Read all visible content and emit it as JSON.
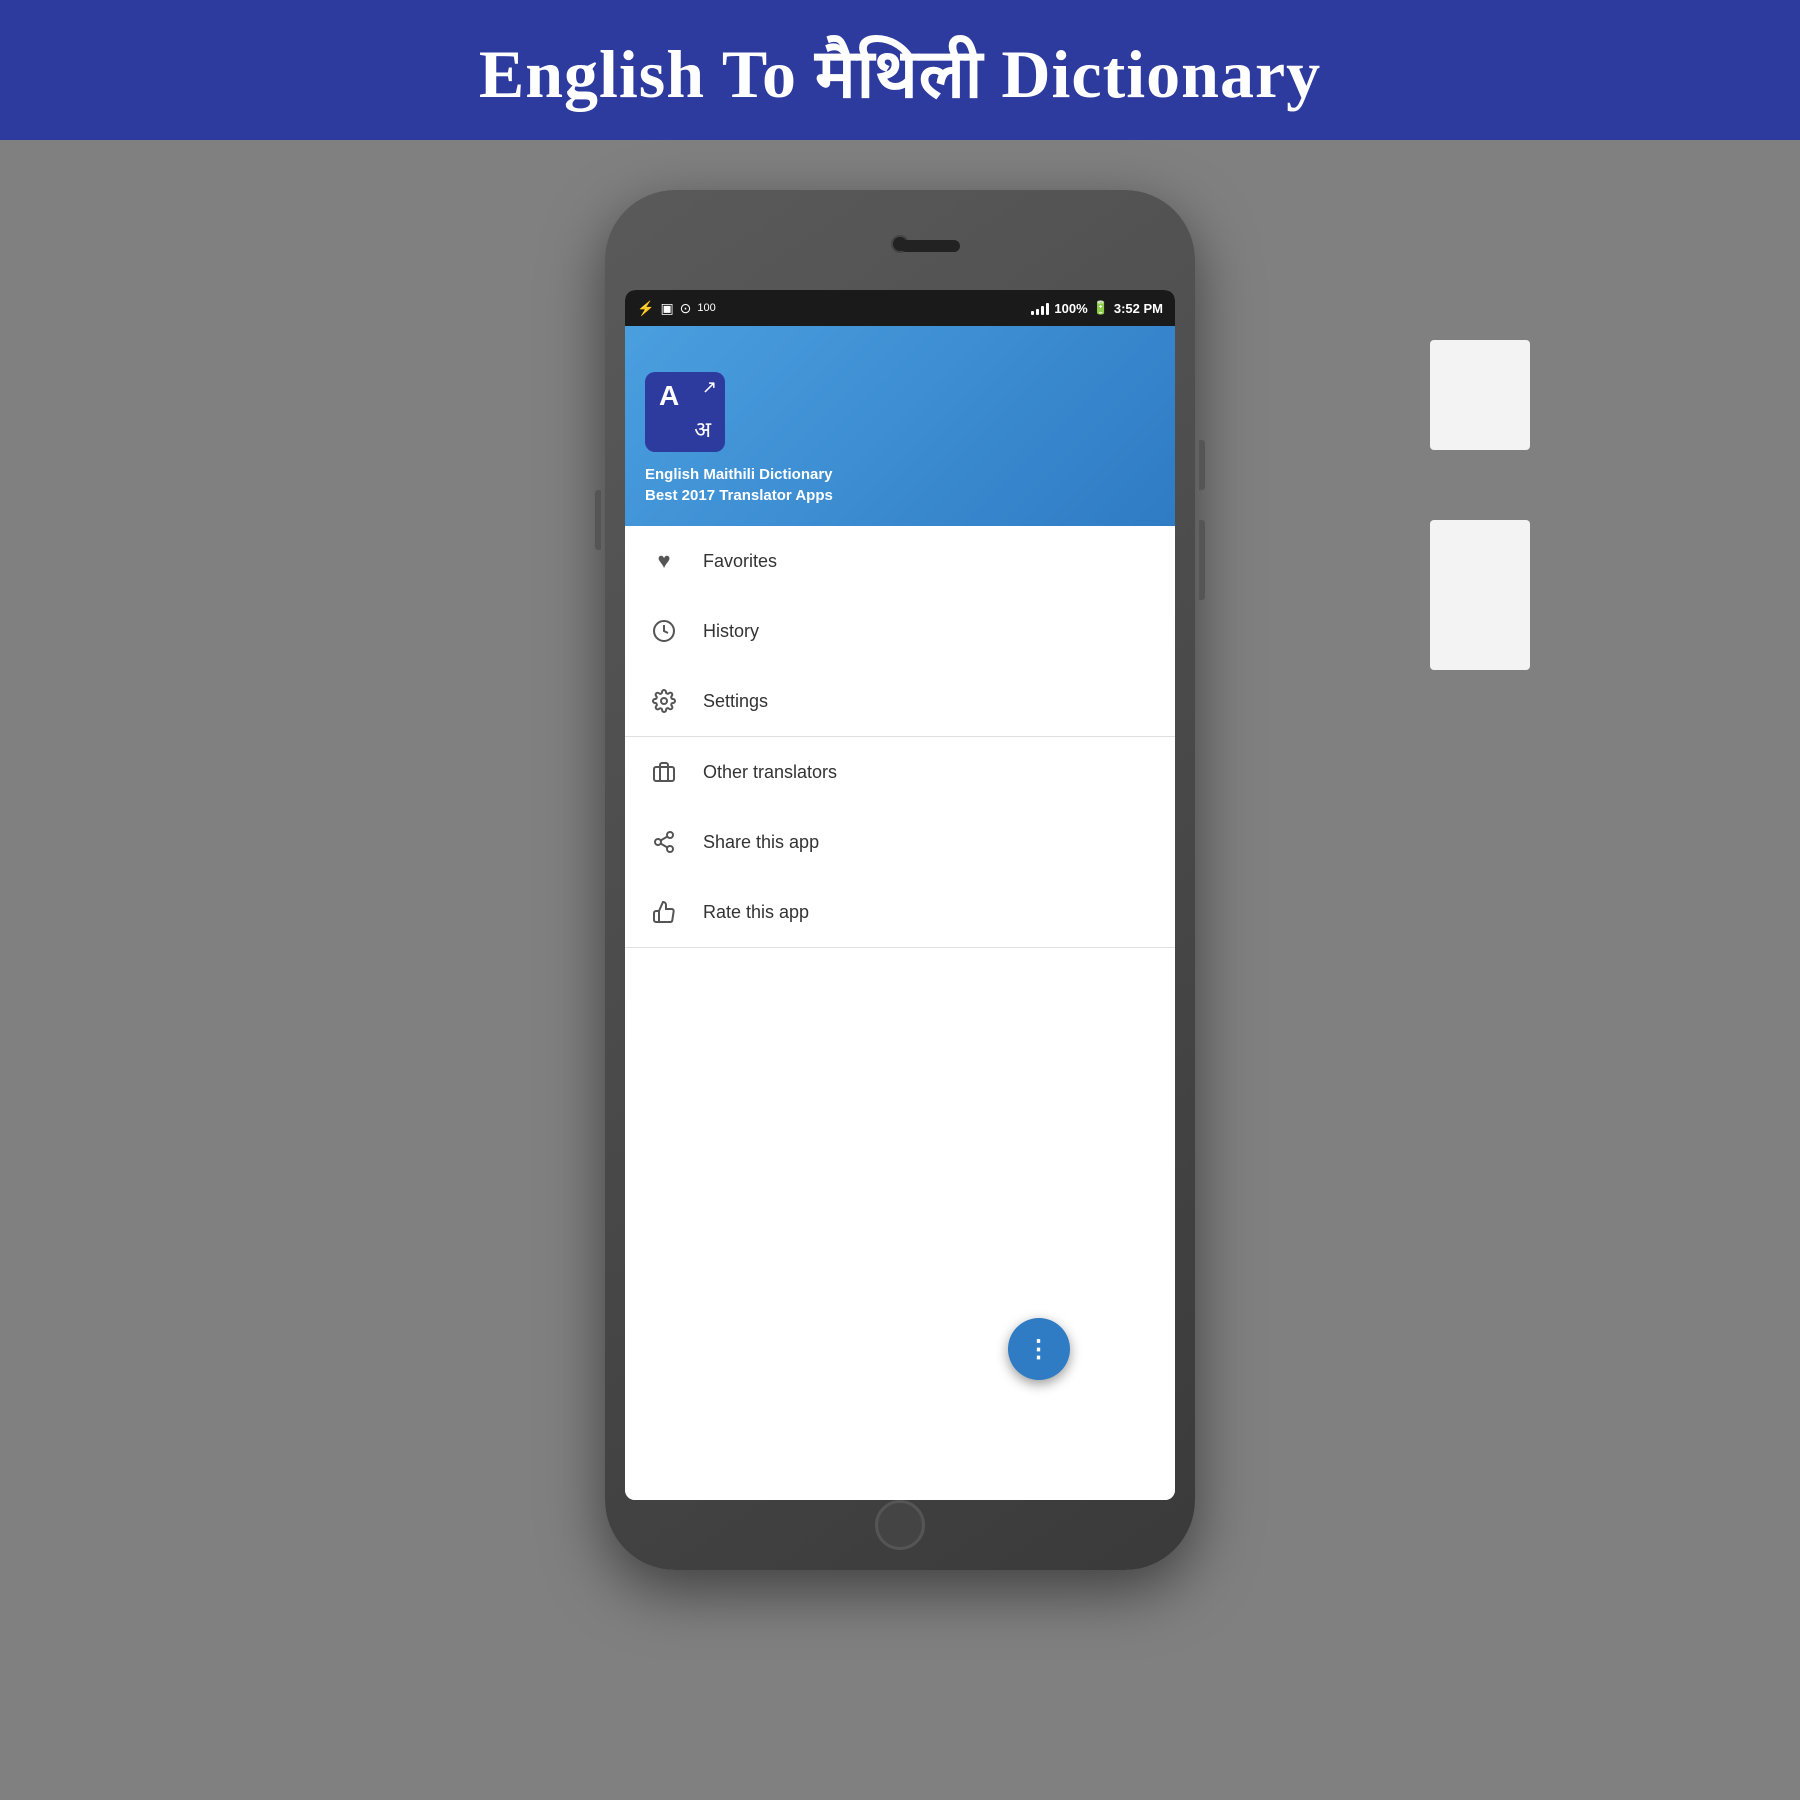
{
  "banner": {
    "title": "English To मैथिली Dictionary"
  },
  "status_bar": {
    "time": "3:52 PM",
    "battery": "100%"
  },
  "app_header": {
    "name_line1": "English Maithili Dictionary",
    "name_line2": "Best 2017 Translator Apps"
  },
  "menu": {
    "section1": [
      {
        "id": "favorites",
        "label": "Favorites",
        "icon": "♥"
      },
      {
        "id": "history",
        "label": "History",
        "icon": "🕐"
      },
      {
        "id": "settings",
        "label": "Settings",
        "icon": "⚙"
      }
    ],
    "section2": [
      {
        "id": "other-translators",
        "label": "Other translators",
        "icon": "🎒"
      },
      {
        "id": "share-app",
        "label": "Share this app",
        "icon": "◁"
      },
      {
        "id": "rate-app",
        "label": "Rate this app",
        "icon": "👍"
      }
    ]
  },
  "fab": {
    "icon": "⋮"
  },
  "app_icon": {
    "letter": "A",
    "hindi_letter": "अ"
  }
}
